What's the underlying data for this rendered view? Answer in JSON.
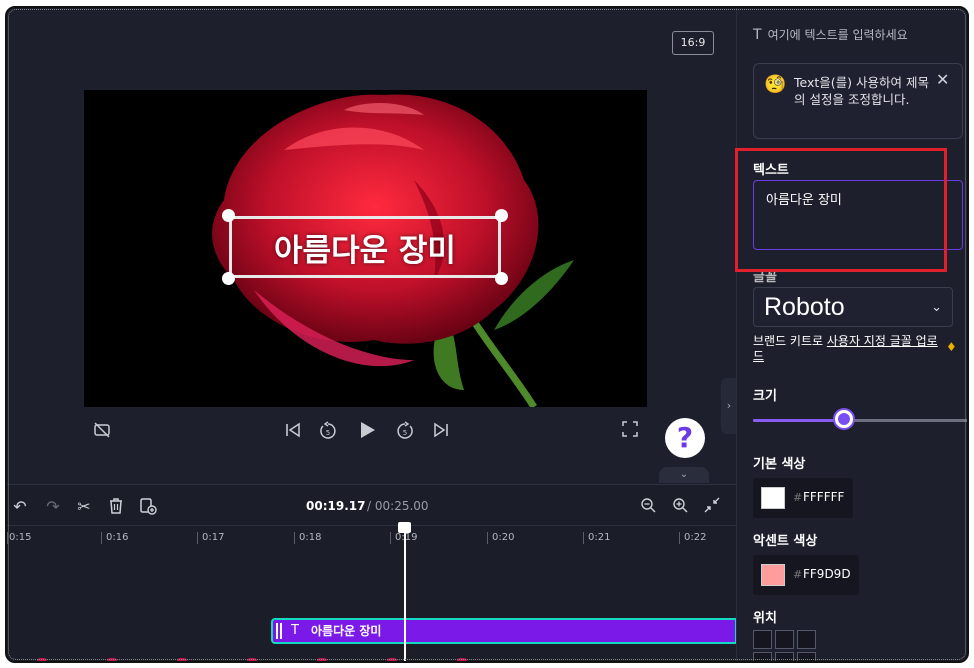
{
  "editor": {
    "aspect_ratio": "16:9",
    "overlay_title": "아름다운 장미"
  },
  "controls": {
    "hide_icon": "camera-off",
    "prev_icon": "skip-back",
    "rewind_icon": "rewind-5",
    "play_icon": "play",
    "forward_icon": "forward-5",
    "next_icon": "skip-forward",
    "fullscreen_icon": "fullscreen",
    "help_label": "?"
  },
  "timeline": {
    "current_time": "00:19.17",
    "separator": "/",
    "total_time": "00:25.00",
    "ticks": [
      "0:15",
      "0:16",
      "0:17",
      "0:18",
      "0:19",
      "0:20",
      "0:21",
      "0:22"
    ],
    "text_clip_label": "아름다운 장미",
    "text_clip_icon": "T"
  },
  "panel": {
    "header_icon": "T",
    "header": "여기에 텍스트를 입력하세요",
    "hint_text": "Text을(를) 사용하여 제목의 설정을 조정합니다.",
    "text_section": "텍스트",
    "text_value": "아름다운 장미",
    "font_section": "글꼴",
    "font_value": "Roboto",
    "brand_prefix": "브랜드 키트로 ",
    "brand_link": "사용자 지정 글꼴 업로드",
    "size_section": "크기",
    "size_level_percent": 44,
    "base_color_section": "기본 색상",
    "base_color_hex": "FFFFFF",
    "base_color": "#FFFFFF",
    "accent_color_section": "악센트 색상",
    "accent_color_hex": "FF9D9D",
    "accent_color": "#FF9D9D",
    "position_section": "위치"
  },
  "colors": {
    "accent": "#7b1ae8",
    "clip_border": "#16d9c3",
    "highlight": "#e0202b"
  }
}
